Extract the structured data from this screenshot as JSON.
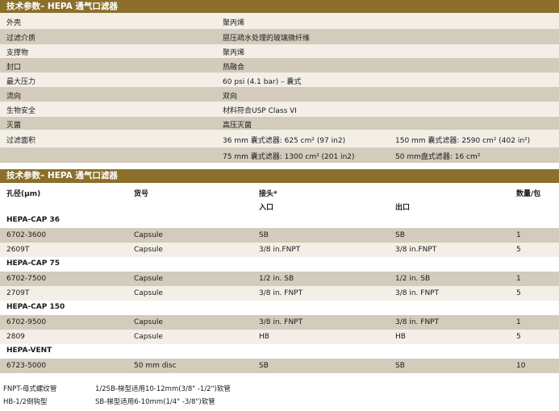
{
  "section1": {
    "title": "技术参数– HEPA 通气口滤器",
    "rows": [
      {
        "label": "外壳",
        "value": "聚丙烯"
      },
      {
        "label": "过滤介质",
        "value": "层压疏水处理的玻璃微纤维"
      },
      {
        "label": "支撑物",
        "value": "聚丙烯"
      },
      {
        "label": "封口",
        "value": "热融合"
      },
      {
        "label": "最大压力",
        "value": "60 psi (4.1 bar) – 囊式"
      },
      {
        "label": "流向",
        "value": "双向"
      },
      {
        "label": "生物安全",
        "value": "材料符合USP Class VI"
      },
      {
        "label": "灭菌",
        "value": "高压灭菌"
      }
    ],
    "area": {
      "label": "过滤面积",
      "a": "36 mm 囊式滤器: 625 cm² (97 in2)",
      "b": "150 mm 囊式滤器: 2590 cm² (402 in²)",
      "c": "75 mm 囊式滤器: 1300 cm² (201 in2)",
      "d": "50 mm盘式滤器: 16 cm²"
    }
  },
  "section2": {
    "title": "技术参数– HEPA 通气口滤器",
    "headers": {
      "pore": "孔径(μm)",
      "catalog": "货号",
      "connector": "接头*",
      "inlet": "入口",
      "outlet": "出口",
      "qty": "数量/包"
    },
    "groups": [
      {
        "name": "HEPA-CAP 36",
        "rows": [
          {
            "code": "6702-3600",
            "type": "Capsule",
            "inlet": "SB",
            "outlet": "SB",
            "qty": "1"
          },
          {
            "code": "2609T",
            "type": "Capsule",
            "inlet": "3/8 in.FNPT",
            "outlet": "3/8 in.FNPT",
            "qty": "5"
          }
        ]
      },
      {
        "name": "HEPA-CAP 75",
        "rows": [
          {
            "code": "6702-7500",
            "type": "Capsule",
            "inlet": "1/2 in. SB",
            "outlet": "1/2 in. SB",
            "qty": "1"
          },
          {
            "code": "2709T",
            "type": "Capsule",
            "inlet": "3/8 in. FNPT",
            "outlet": "3/8 in. FNPT",
            "qty": "5"
          }
        ]
      },
      {
        "name": "HEPA-CAP 150",
        "rows": [
          {
            "code": "6702-9500",
            "type": "Capsule",
            "inlet": "3/8 in. FNPT",
            "outlet": "3/8 in. FNPT",
            "qty": "1"
          },
          {
            "code": "2809",
            "type": "Capsule",
            "inlet": "HB",
            "outlet": "HB",
            "qty": "5"
          }
        ]
      },
      {
        "name": "HEPA-VENT",
        "rows": [
          {
            "code": "6723-5000",
            "type": "50 mm disc",
            "inlet": "SB",
            "outlet": "SB",
            "qty": "10"
          }
        ]
      }
    ]
  },
  "footnotes": {
    "f1": "FNPT-母式螺纹管",
    "f2": "1/2SB-梯型适用10-12mm(3/8\" -1/2\")软管",
    "f3": "HB-1/2倒钩型",
    "f4": "SB-梯型适用6-10mm(1/4\" -3/8\")软管"
  },
  "colors": {
    "banner": "#8b6f2a",
    "row_dark": "#d3cbbb",
    "row_light": "#f3efe7"
  }
}
